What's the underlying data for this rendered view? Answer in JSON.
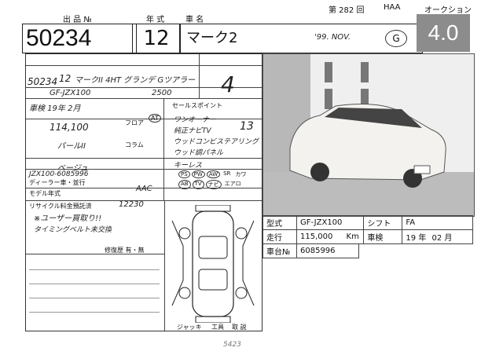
{
  "header": {
    "lot_label": "出 品 №",
    "year_label": "年 式",
    "model_label": "車 名",
    "session": "第 282 回",
    "house": "HAA",
    "auction": "オークション"
  },
  "lot_number": "50234",
  "year": "12",
  "model_name": "マーク2",
  "grade_score": "4.0",
  "handwritten": {
    "date_note": "'99. NOV.",
    "circle_g": "G",
    "lot_small": "50234",
    "year_small": "12",
    "model_small": "マークII 4HT グランデ Gツアラー",
    "chassis": "GF-JZX100",
    "displacement": "2500",
    "score": "4",
    "shaken": "車検 19年 2月",
    "mileage": "114,100",
    "color": "パールII",
    "interior": "ベージュ",
    "serial": "JZX100-6085996",
    "notes_1": "※ユーザー買取り!!",
    "notes_2": "タイミングベルト未交換",
    "equip_1": "ワンオーナー",
    "equip_2": "純正ナビTV",
    "equip_3": "ウッドコンビステアリング",
    "equip_4": "ウッド調パネル",
    "equip_5": "キーレス",
    "right_nums": "13",
    "bottom_note": "5423",
    "ac": "AAC",
    "recycle": "12230"
  },
  "sheet_labels": {
    "sales_point": "セールスポイント",
    "floor": "フロア",
    "column": "コラム",
    "at": "AT",
    "dealer": "ディーラー車・並行",
    "model_year": "モデル年式",
    "recycle": "リサイクル料金預託済",
    "repair": "修復歴 有・無",
    "options": [
      "PS",
      "PW",
      "AW",
      "SR",
      "カワ",
      "AB",
      "TV",
      "ナビ",
      "エアロ"
    ],
    "jack": "ジャッキ",
    "tools": "工具",
    "manual": "取 説"
  },
  "info": {
    "type_label": "型式",
    "type_value": "GF-JZX100",
    "shift_label": "シフト",
    "shift_value": "FA",
    "mileage_label": "走行",
    "mileage_value": "115,000",
    "mileage_unit": "Km",
    "inspection_label": "車検",
    "inspection_year": "19",
    "inspection_year_unit": "年",
    "inspection_month": "02",
    "inspection_month_unit": "月",
    "frame_label": "車台№",
    "frame_value": "6085996"
  }
}
